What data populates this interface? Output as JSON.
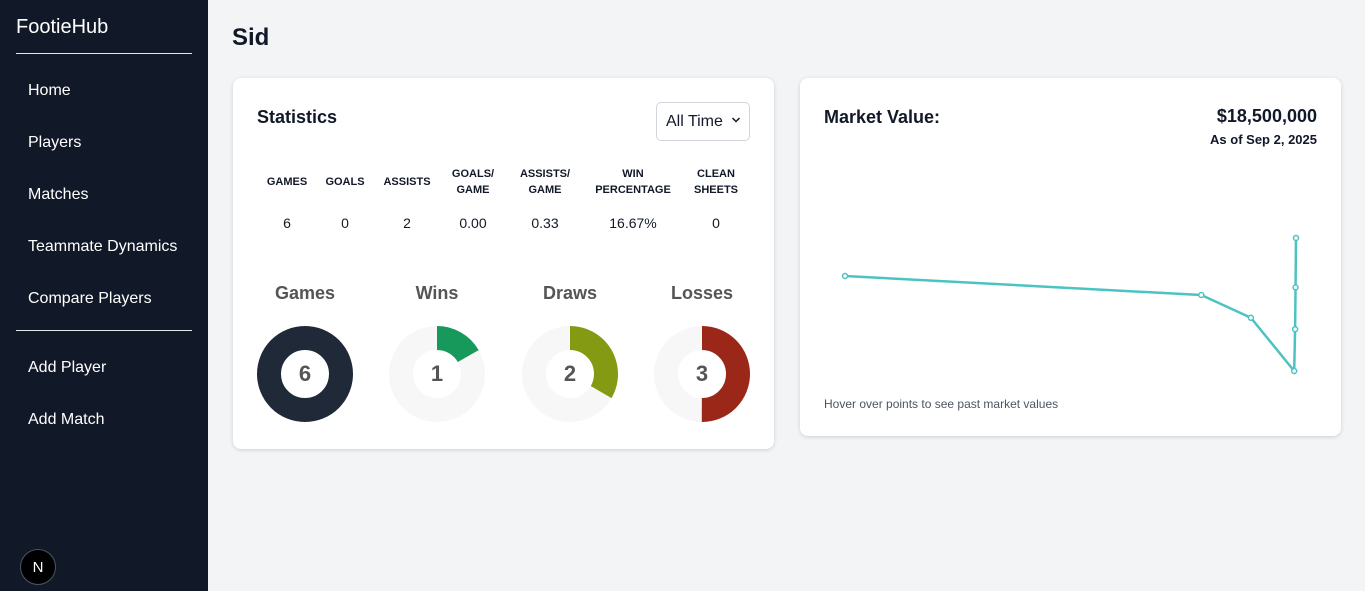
{
  "sidebar": {
    "brand": "FootieHub",
    "nav": [
      "Home",
      "Players",
      "Matches",
      "Teammate Dynamics",
      "Compare Players"
    ],
    "actions": [
      "Add Player",
      "Add Match"
    ],
    "badge": "N"
  },
  "page": {
    "title": "Sid"
  },
  "statistics": {
    "title": "Statistics",
    "filter": "All Time",
    "headers": [
      [
        "GAMES"
      ],
      [
        "GOALS"
      ],
      [
        "ASSISTS"
      ],
      [
        "GOALS/",
        "GAME"
      ],
      [
        "ASSISTS/",
        "GAME"
      ],
      [
        "WIN",
        "PERCENTAGE"
      ],
      [
        "CLEAN",
        "SHEETS"
      ]
    ],
    "values": [
      "6",
      "0",
      "2",
      "0.00",
      "0.33",
      "16.67%",
      "0"
    ],
    "donuts": [
      {
        "label": "Games",
        "value": "6",
        "fraction": 1.0,
        "color": "#1f2937"
      },
      {
        "label": "Wins",
        "value": "1",
        "fraction": 0.1667,
        "color": "#16995a"
      },
      {
        "label": "Draws",
        "value": "2",
        "fraction": 0.3333,
        "color": "#849a12"
      },
      {
        "label": "Losses",
        "value": "3",
        "fraction": 0.5,
        "color": "#9a2718"
      }
    ],
    "donut_track_color": "#f7f7f7"
  },
  "market": {
    "title": "Market Value:",
    "value": "$18,500,000",
    "date": "As of Sep 2, 2025",
    "hint": "Hover over points to see past market values",
    "line_color": "#4cc3c3"
  },
  "chart_data": {
    "type": "line",
    "title": "Market Value:",
    "points": [
      {
        "x": 0.0,
        "y": 0.5
      },
      {
        "x": 0.79,
        "y": 0.4
      },
      {
        "x": 0.9,
        "y": 0.28
      },
      {
        "x": 0.996,
        "y": 0.0
      },
      {
        "x": 0.998,
        "y": 0.22
      },
      {
        "x": 0.999,
        "y": 0.44
      },
      {
        "x": 1.0,
        "y": 0.7
      }
    ]
  }
}
